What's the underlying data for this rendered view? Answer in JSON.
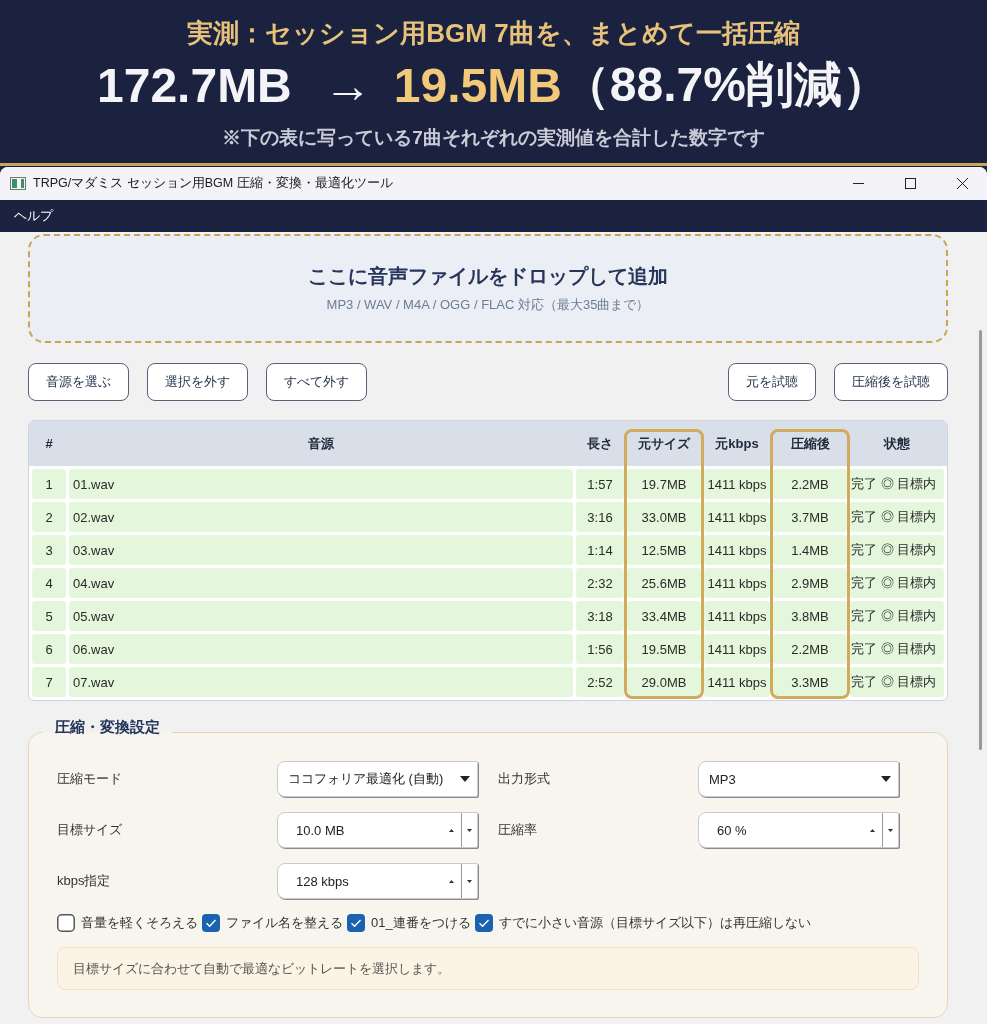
{
  "banner": {
    "title": "実測：セッション用BGM 7曲を、まとめて一括圧縮",
    "before": "172.7MB",
    "arrow": "→",
    "after": "19.5MB",
    "reduction": "（88.7%削減）",
    "note": "※下の表に写っている7曲それぞれの実測値を合計した数字です"
  },
  "window": {
    "title": "TRPG/マダミス セッション用BGM 圧縮・変換・最適化ツール"
  },
  "menu": [
    "ヘルプ"
  ],
  "drop_zone": {
    "title": "ここに音声ファイルをドロップして追加",
    "subtitle": "MP3 / WAV / M4A / OGG / FLAC 対応（最大35曲まで）"
  },
  "toolbar": {
    "left_buttons": [
      "音源を選ぶ",
      "選択を外す",
      "すべて外す"
    ],
    "right_buttons": [
      "元を試聴",
      "圧縮後を試聴"
    ]
  },
  "table": {
    "columns": [
      {
        "label": "#",
        "highlighted": false
      },
      {
        "label": "音源",
        "highlighted": false
      },
      {
        "label": "長さ",
        "highlighted": false
      },
      {
        "label": "元サイズ",
        "highlighted": true
      },
      {
        "label": "元kbps",
        "highlighted": false
      },
      {
        "label": "圧縮後",
        "highlighted": true
      },
      {
        "label": "状態",
        "highlighted": false
      }
    ],
    "rows": [
      [
        "1",
        "01.wav",
        "1:57",
        "19.7MB",
        "1411 kbps",
        "2.2MB",
        "完了 ◎ 目標内"
      ],
      [
        "2",
        "02.wav",
        "3:16",
        "33.0MB",
        "1411 kbps",
        "3.7MB",
        "完了 ◎ 目標内"
      ],
      [
        "3",
        "03.wav",
        "1:14",
        "12.5MB",
        "1411 kbps",
        "1.4MB",
        "完了 ◎ 目標内"
      ],
      [
        "4",
        "04.wav",
        "2:32",
        "25.6MB",
        "1411 kbps",
        "2.9MB",
        "完了 ◎ 目標内"
      ],
      [
        "5",
        "05.wav",
        "3:18",
        "33.4MB",
        "1411 kbps",
        "3.8MB",
        "完了 ◎ 目標内"
      ],
      [
        "6",
        "06.wav",
        "1:56",
        "19.5MB",
        "1411 kbps",
        "2.2MB",
        "完了 ◎ 目標内"
      ],
      [
        "7",
        "07.wav",
        "2:52",
        "29.0MB",
        "1411 kbps",
        "3.3MB",
        "完了 ◎ 目標内"
      ]
    ]
  },
  "settings": {
    "title": "圧縮・変換設定",
    "fields": [
      {
        "label": "圧縮モード",
        "kind": "select",
        "value": "ココフォリア最適化 (自動)"
      },
      {
        "label": "出力形式",
        "kind": "select",
        "value": "MP3"
      },
      {
        "label": "目標サイズ",
        "kind": "spin",
        "value": "10.0 MB"
      },
      {
        "label": "圧縮率",
        "kind": "spin",
        "value": "60 %"
      },
      {
        "label": "kbps指定",
        "kind": "spin",
        "value": "128 kbps"
      }
    ],
    "options": [
      {
        "label": "音量を軽くそろえる",
        "checked": false
      },
      {
        "label": "ファイル名を整える",
        "checked": true
      },
      {
        "label": "01_連番をつける",
        "checked": true
      },
      {
        "label": "すでに小さい音源（目標サイズ以下）は再圧縮しない",
        "checked": true
      }
    ],
    "hint": "目標サイズに合わせて自動で最適なビットレートを選択します。"
  }
}
